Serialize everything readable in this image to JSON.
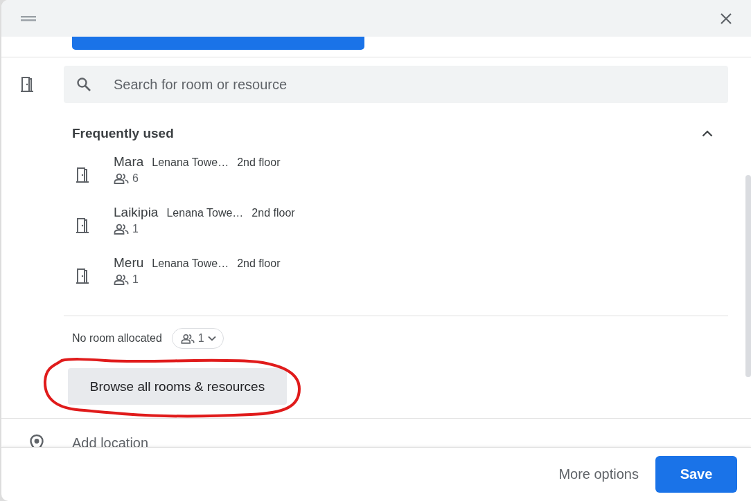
{
  "search": {
    "placeholder": "Search for room or resource"
  },
  "frequently_used": {
    "title": "Frequently used",
    "expanded": true,
    "rooms": [
      {
        "name": "Mara",
        "building": "Lenana Towe…",
        "floor": "2nd floor",
        "capacity": "6"
      },
      {
        "name": "Laikipia",
        "building": "Lenana Towe…",
        "floor": "2nd floor",
        "capacity": "1"
      },
      {
        "name": "Meru",
        "building": "Lenana Towe…",
        "floor": "2nd floor",
        "capacity": "1"
      }
    ]
  },
  "no_room": {
    "label": "No room allocated",
    "attendees": "1"
  },
  "browse_button": "Browse all rooms & resources",
  "location": {
    "placeholder": "Add location"
  },
  "footer": {
    "more_options": "More options",
    "save": "Save"
  }
}
